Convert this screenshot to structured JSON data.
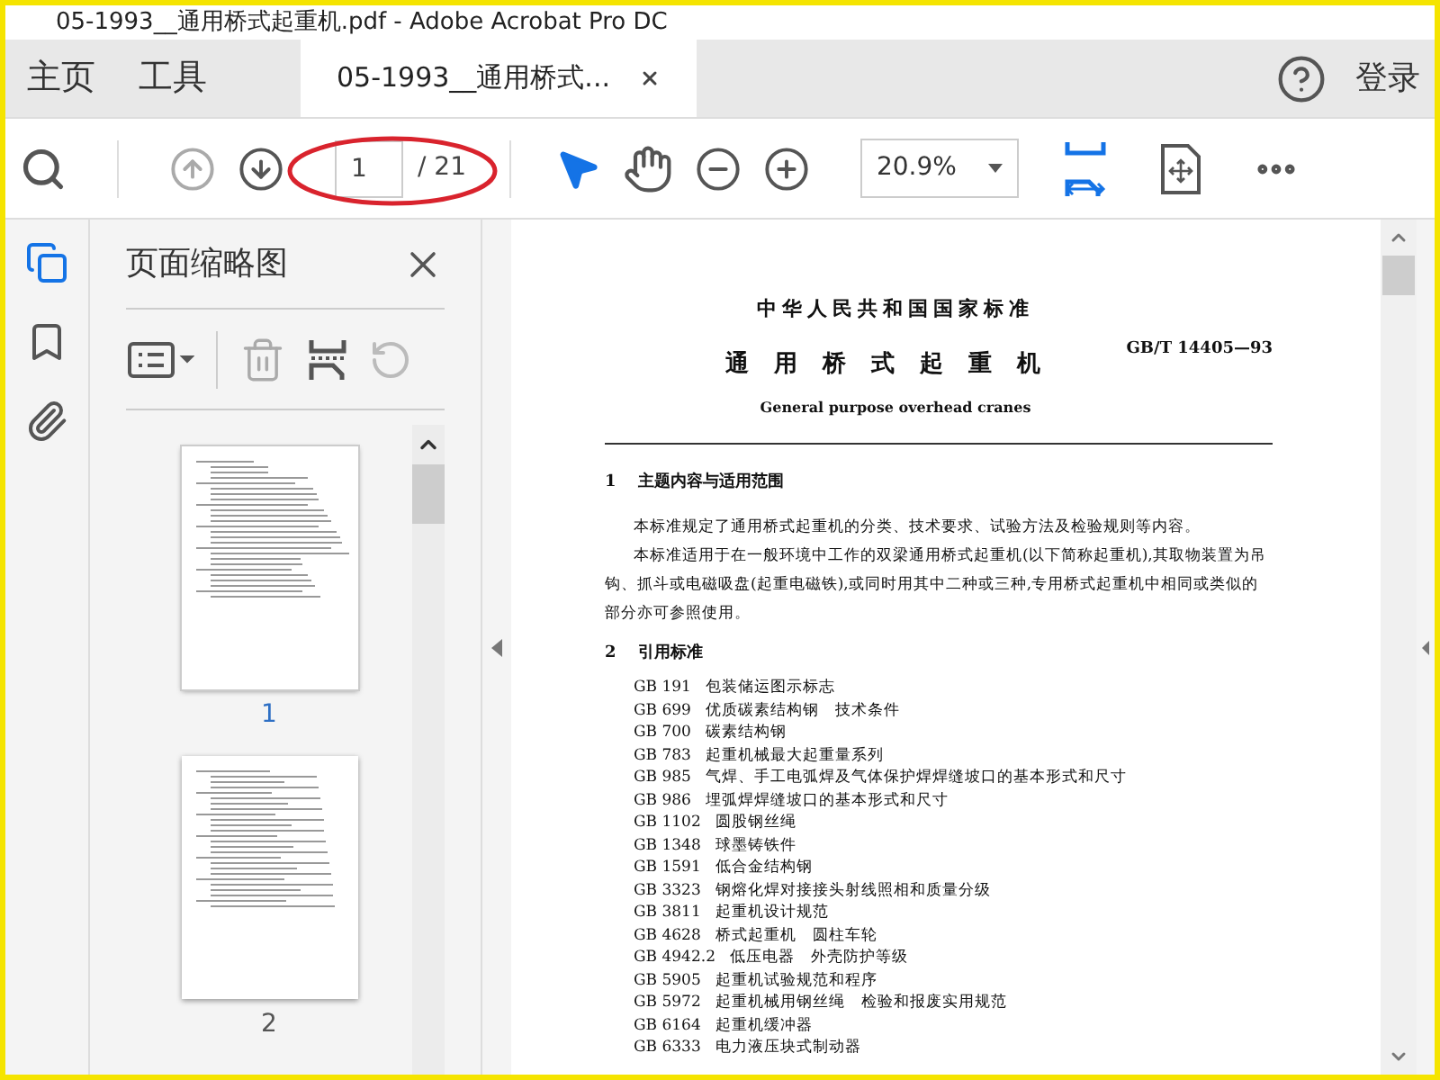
{
  "window": {
    "title": "05-1993__通用桥式起重机.pdf - Adobe Acrobat Pro DC"
  },
  "tabs": [
    {
      "kind": "home",
      "label": "主页",
      "selected": false
    },
    {
      "kind": "home",
      "label": "工具",
      "selected": false
    },
    {
      "kind": "document",
      "label": "05-1993__通用桥式...",
      "selected": true
    }
  ],
  "account": {
    "login": "登录"
  },
  "toolbar": {
    "page_input": "1",
    "page_total": "/ 21",
    "zoom": "20.9%"
  },
  "rail_items": [
    {
      "kind": "pages",
      "selected": true
    },
    {
      "kind": "bookmarks",
      "selected": false
    },
    {
      "kind": "attachments",
      "selected": false
    }
  ],
  "sidebar": {
    "title": "页面缩略图",
    "thumbnails": [
      {
        "label": "1",
        "selected": true
      },
      {
        "label": "2",
        "selected": false
      }
    ]
  },
  "document": {
    "heading": "中华人民共和国国家标准",
    "code": "GB/T 14405—93",
    "title": "通用桥式起重机",
    "subtitle": "General purpose overhead cranes",
    "section_1": {
      "number": "1",
      "heading": "主题内容与适用范围",
      "paragraphs": [
        "本标准规定了通用桥式起重机的分类、技术要求、试验方法及检验规则等内容。",
        "本标准适用于在一般环境中工作的双梁通用桥式起重机(以下简称起重机),其取物装置为吊钩、抓斗或电磁吸盘(起重电磁铁),或同时用其中二种或三种,专用桥式起重机中相同或类似的部分亦可参照使用。"
      ]
    },
    "section_2": {
      "number": "2",
      "heading": "引用标准",
      "references": [
        {
          "code": "GB 191",
          "title": "包装储运图示标志"
        },
        {
          "code": "GB 699",
          "title": "优质碳素结构钢　技术条件"
        },
        {
          "code": "GB 700",
          "title": "碳素结构钢"
        },
        {
          "code": "GB 783",
          "title": "起重机械最大起重量系列"
        },
        {
          "code": "GB 985",
          "title": "气焊、手工电弧焊及气体保护焊焊缝坡口的基本形式和尺寸"
        },
        {
          "code": "GB 986",
          "title": "埋弧焊焊缝坡口的基本形式和尺寸"
        },
        {
          "code": "GB 1102",
          "title": "圆股钢丝绳"
        },
        {
          "code": "GB 1348",
          "title": "球墨铸铁件"
        },
        {
          "code": "GB 1591",
          "title": "低合金结构钢"
        },
        {
          "code": "GB 3323",
          "title": "钢熔化焊对接接头射线照相和质量分级"
        },
        {
          "code": "GB 3811",
          "title": "起重机设计规范"
        },
        {
          "code": "GB 4628",
          "title": "桥式起重机　圆柱车轮"
        },
        {
          "code": "GB 4942.2",
          "title": "低压电器　外壳防护等级"
        },
        {
          "code": "GB 5905",
          "title": "起重机试验规范和程序"
        },
        {
          "code": "GB 5972",
          "title": "起重机械用钢丝绳　检验和报废实用规范"
        },
        {
          "code": "GB 6164",
          "title": "起重机缓冲器"
        },
        {
          "code": "GB 6333",
          "title": "电力液压块式制动器"
        }
      ]
    }
  }
}
